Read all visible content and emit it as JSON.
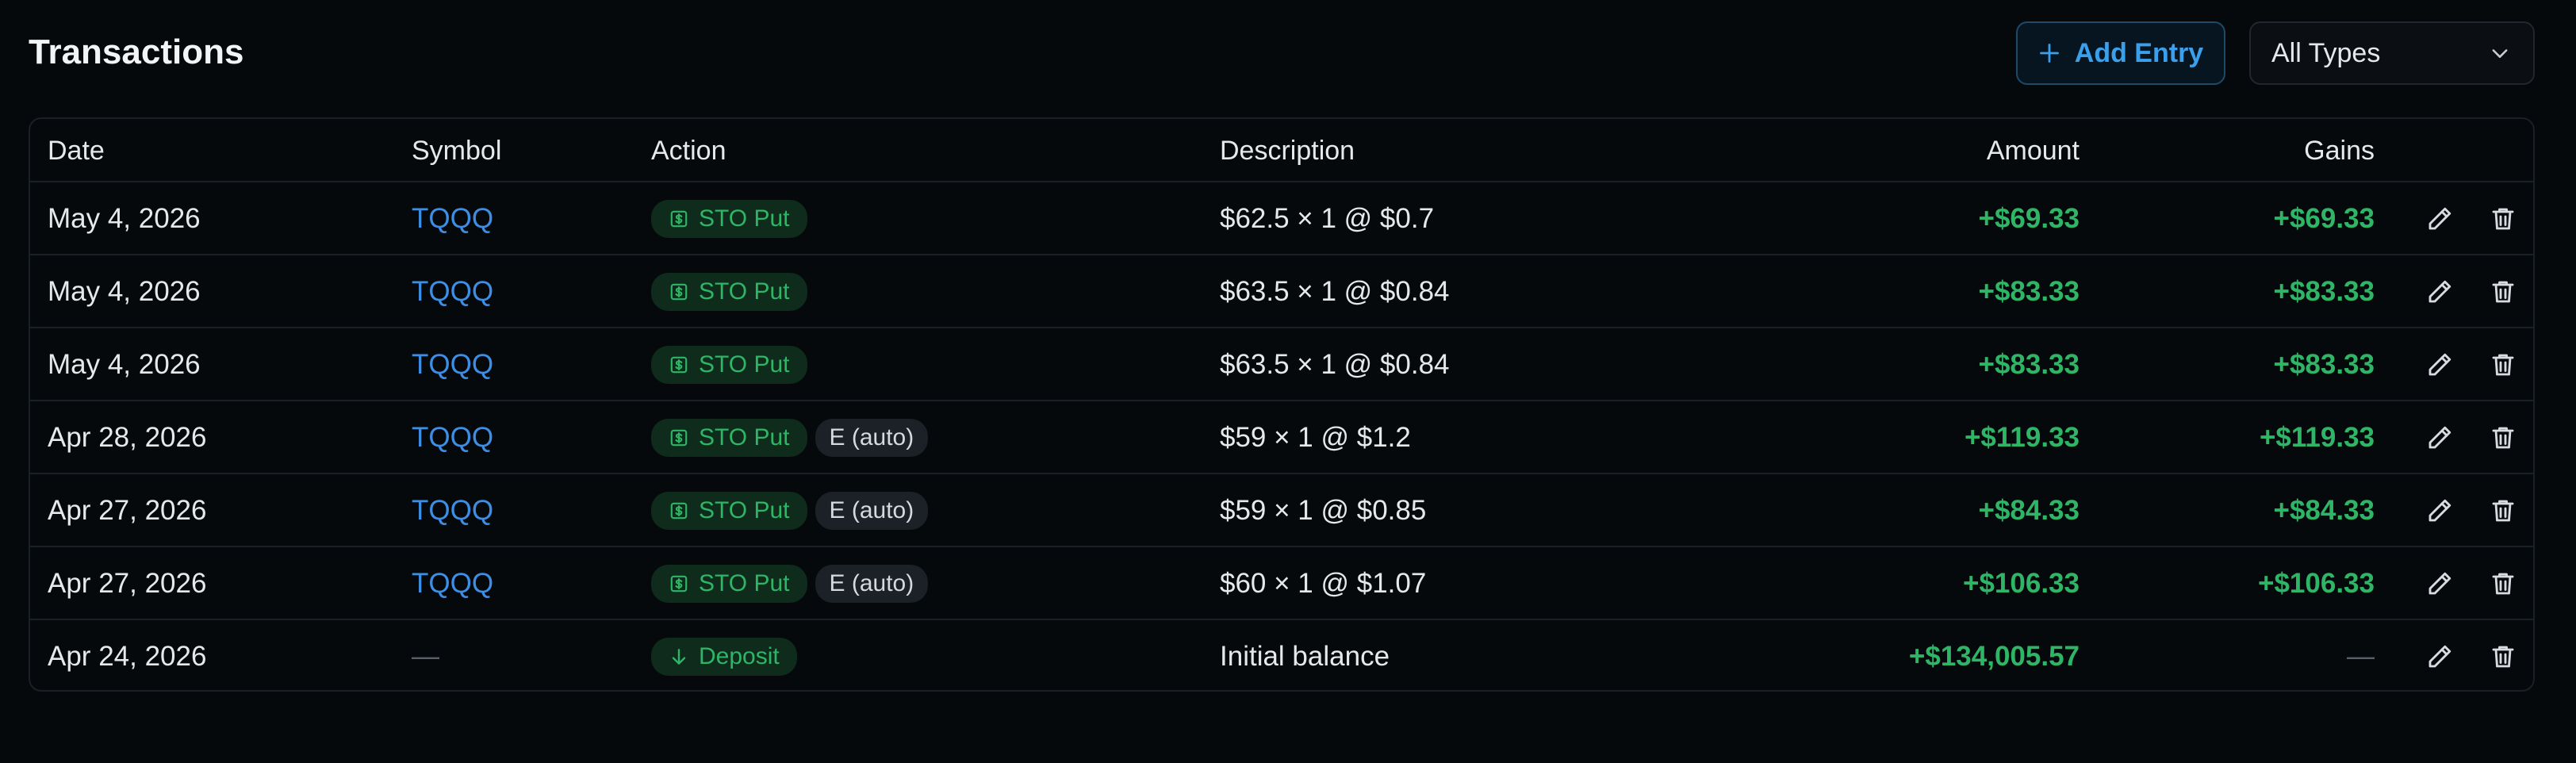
{
  "header": {
    "title": "Transactions",
    "add_entry_label": "Add Entry",
    "type_filter": {
      "selected": "All Types"
    }
  },
  "columns": {
    "date": "Date",
    "symbol": "Symbol",
    "action": "Action",
    "description": "Description",
    "amount": "Amount",
    "gains": "Gains"
  },
  "rows": [
    {
      "date": "May 4, 2026",
      "symbol": "TQQQ",
      "action": "STO Put",
      "action_icon": "dollar-square-icon",
      "extra_badge": "",
      "description": "$62.5 × 1 @ $0.7",
      "amount": "+$69.33",
      "gains": "+$69.33"
    },
    {
      "date": "May 4, 2026",
      "symbol": "TQQQ",
      "action": "STO Put",
      "action_icon": "dollar-square-icon",
      "extra_badge": "",
      "description": "$63.5 × 1 @ $0.84",
      "amount": "+$83.33",
      "gains": "+$83.33"
    },
    {
      "date": "May 4, 2026",
      "symbol": "TQQQ",
      "action": "STO Put",
      "action_icon": "dollar-square-icon",
      "extra_badge": "",
      "description": "$63.5 × 1 @ $0.84",
      "amount": "+$83.33",
      "gains": "+$83.33"
    },
    {
      "date": "Apr 28, 2026",
      "symbol": "TQQQ",
      "action": "STO Put",
      "action_icon": "dollar-square-icon",
      "extra_badge": "E (auto)",
      "description": "$59 × 1 @ $1.2",
      "amount": "+$119.33",
      "gains": "+$119.33"
    },
    {
      "date": "Apr 27, 2026",
      "symbol": "TQQQ",
      "action": "STO Put",
      "action_icon": "dollar-square-icon",
      "extra_badge": "E (auto)",
      "description": "$59 × 1 @ $0.85",
      "amount": "+$84.33",
      "gains": "+$84.33"
    },
    {
      "date": "Apr 27, 2026",
      "symbol": "TQQQ",
      "action": "STO Put",
      "action_icon": "dollar-square-icon",
      "extra_badge": "E (auto)",
      "description": "$60 × 1 @ $1.07",
      "amount": "+$106.33",
      "gains": "+$106.33"
    },
    {
      "date": "Apr 24, 2026",
      "symbol": "—",
      "action": "Deposit",
      "action_icon": "arrow-down-icon",
      "extra_badge": "",
      "description": "Initial balance",
      "amount": "+$134,005.57",
      "gains": "—"
    }
  ],
  "colors": {
    "background": "#06090c",
    "accent": "#3aa0ec",
    "positive": "#2fb566",
    "link": "#3d8fe6"
  }
}
